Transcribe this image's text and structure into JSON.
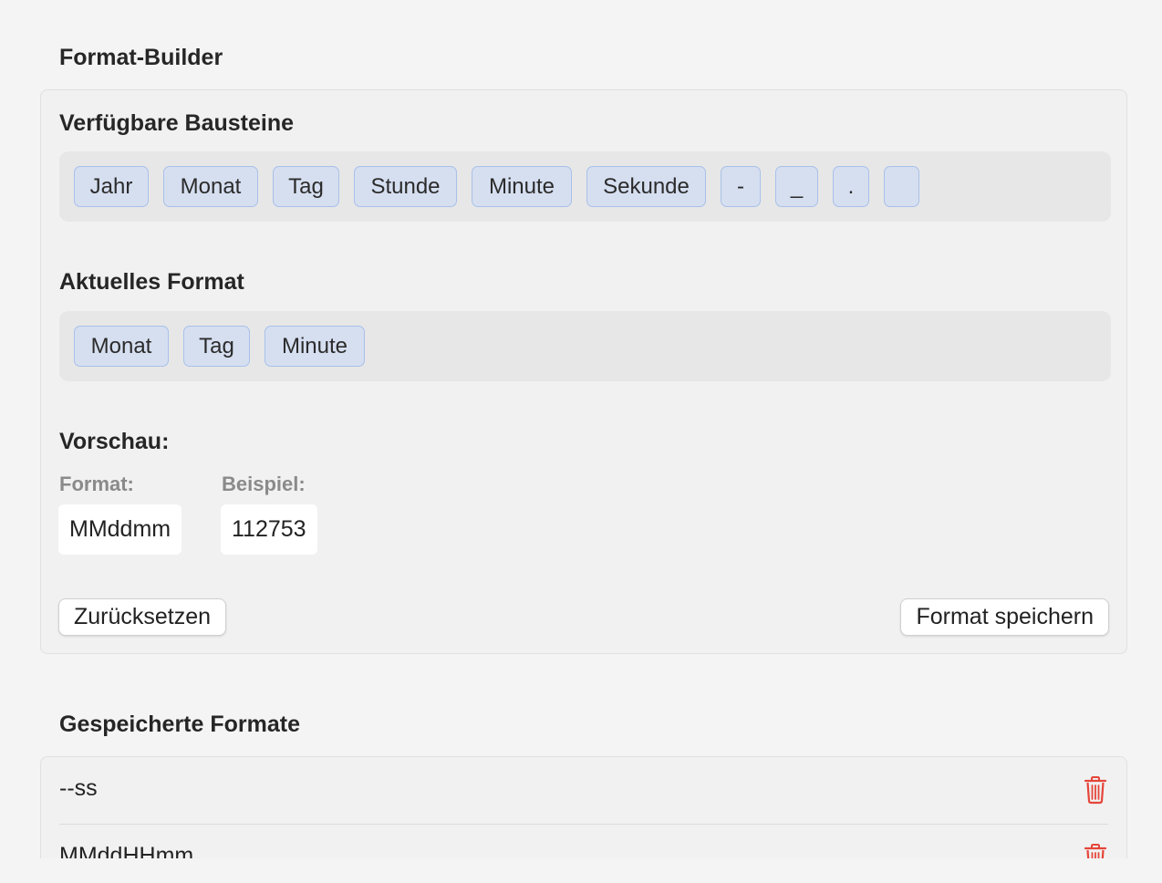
{
  "builder": {
    "section_title": "Format-Builder",
    "available_title": "Verfügbare Bausteine",
    "available_chips": [
      "Jahr",
      "Monat",
      "Tag",
      "Stunde",
      "Minute",
      "Sekunde",
      "-",
      "_",
      ".",
      ""
    ],
    "current_title": "Aktuelles Format",
    "current_chips": [
      "Monat",
      "Tag",
      "Minute"
    ],
    "preview_title": "Vorschau:",
    "format_label": "Format:",
    "format_value": "MMddmm",
    "example_label": "Beispiel:",
    "example_value": "112753",
    "reset_label": "Zurücksetzen",
    "save_label": "Format speichern"
  },
  "saved": {
    "section_title": "Gespeicherte Formate",
    "items": [
      "--ss",
      "MMddHHmm"
    ]
  },
  "colors": {
    "chip_fill": "#d6dff0",
    "chip_border": "#a8c0ea",
    "trash": "#e5453a"
  },
  "icons": {
    "delete": "trash-icon"
  }
}
